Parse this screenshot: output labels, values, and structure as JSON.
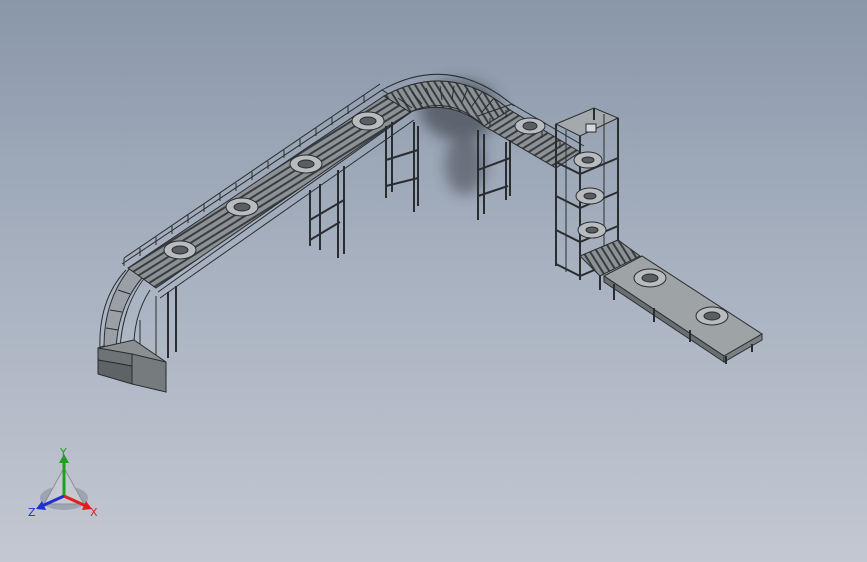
{
  "viewport": {
    "background_top": "#8a97a9",
    "background_bottom": "#c3c8d2"
  },
  "model": {
    "line_color": "#2a2d30",
    "frame_color": "#3c3f42",
    "shadow_color": "#2f3338"
  },
  "triad": {
    "x_label": "X",
    "y_label": "Y",
    "z_label": "Z",
    "x_color": "#e02020",
    "y_color": "#1fa01f",
    "z_color": "#2030d0"
  }
}
